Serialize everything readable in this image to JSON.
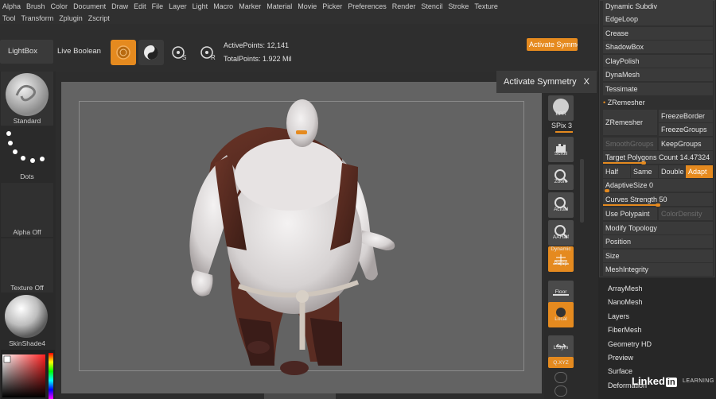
{
  "menu": {
    "row1": [
      "Alpha",
      "Brush",
      "Color",
      "Document",
      "Draw",
      "Edit",
      "File",
      "Layer",
      "Light",
      "Macro",
      "Marker",
      "Material",
      "Movie",
      "Picker",
      "Preferences",
      "Render",
      "Stencil",
      "Stroke",
      "Texture"
    ],
    "row2": [
      "Tool",
      "Transform",
      "Zplugin",
      "Zscript"
    ]
  },
  "toolbar": {
    "lightbox": "LightBox",
    "live_boolean": "Live Boolean",
    "active_points": "ActivePoints: 12,141",
    "total_points": "TotalPoints: 1.922 Mil",
    "activate_symmetry": "Activate Symmetry"
  },
  "tooltip": {
    "text": "Activate Symmetry",
    "close": "X"
  },
  "shelf": {
    "brush": "Standard",
    "stroke": "Dots",
    "alpha": "Alpha Off",
    "texture": "Texture Off",
    "material": "SkinShade4"
  },
  "rstrip": {
    "bpr": "BPR",
    "spix": "SPix 3",
    "scroll": "Scroll",
    "zoom": "Zoom",
    "actual": "Actual",
    "aahalf": "AAHalf",
    "dynamic": "Dynamic",
    "persp": "Persp",
    "floor": "Floor",
    "local": "Local",
    "lsym": "L.Sym",
    "xyz": "Q.XYZ"
  },
  "geometry": {
    "dynamic_subdiv": "Dynamic Subdiv",
    "edgeloop": "EdgeLoop",
    "crease": "Crease",
    "shadowbox": "ShadowBox",
    "claypolish": "ClayPolish",
    "dynamesh": "DynaMesh",
    "tessimate": "Tessimate",
    "zremesher_header": "ZRemesher",
    "zremesher_btn": "ZRemesher",
    "freezeborder": "FreezeBorder",
    "freezegroups": "FreezeGroups",
    "smoothgroups": "SmoothGroups",
    "keepgroups": "KeepGroups",
    "target_polygons": "Target Polygons Count 14.47324",
    "half": "Half",
    "same": "Same",
    "double": "Double",
    "adapt": "Adapt",
    "adaptive_size": "AdaptiveSize 0",
    "curves_strength": "Curves Strength 50",
    "use_polypaint": "Use Polypaint",
    "color_density": "ColorDensity",
    "modify_topology": "Modify Topology",
    "position": "Position",
    "size": "Size",
    "mesh_integrity": "MeshIntegrity"
  },
  "tool_sections": [
    "ArrayMesh",
    "NanoMesh",
    "Layers",
    "FiberMesh",
    "Geometry HD",
    "Preview",
    "Surface",
    "Deformation"
  ],
  "watermark": {
    "brand": "Linked",
    "in": "in",
    "learning": "LEARNING"
  },
  "colors": {
    "accent": "#e58a1f",
    "panel": "#303030",
    "canvas": "#636363"
  }
}
